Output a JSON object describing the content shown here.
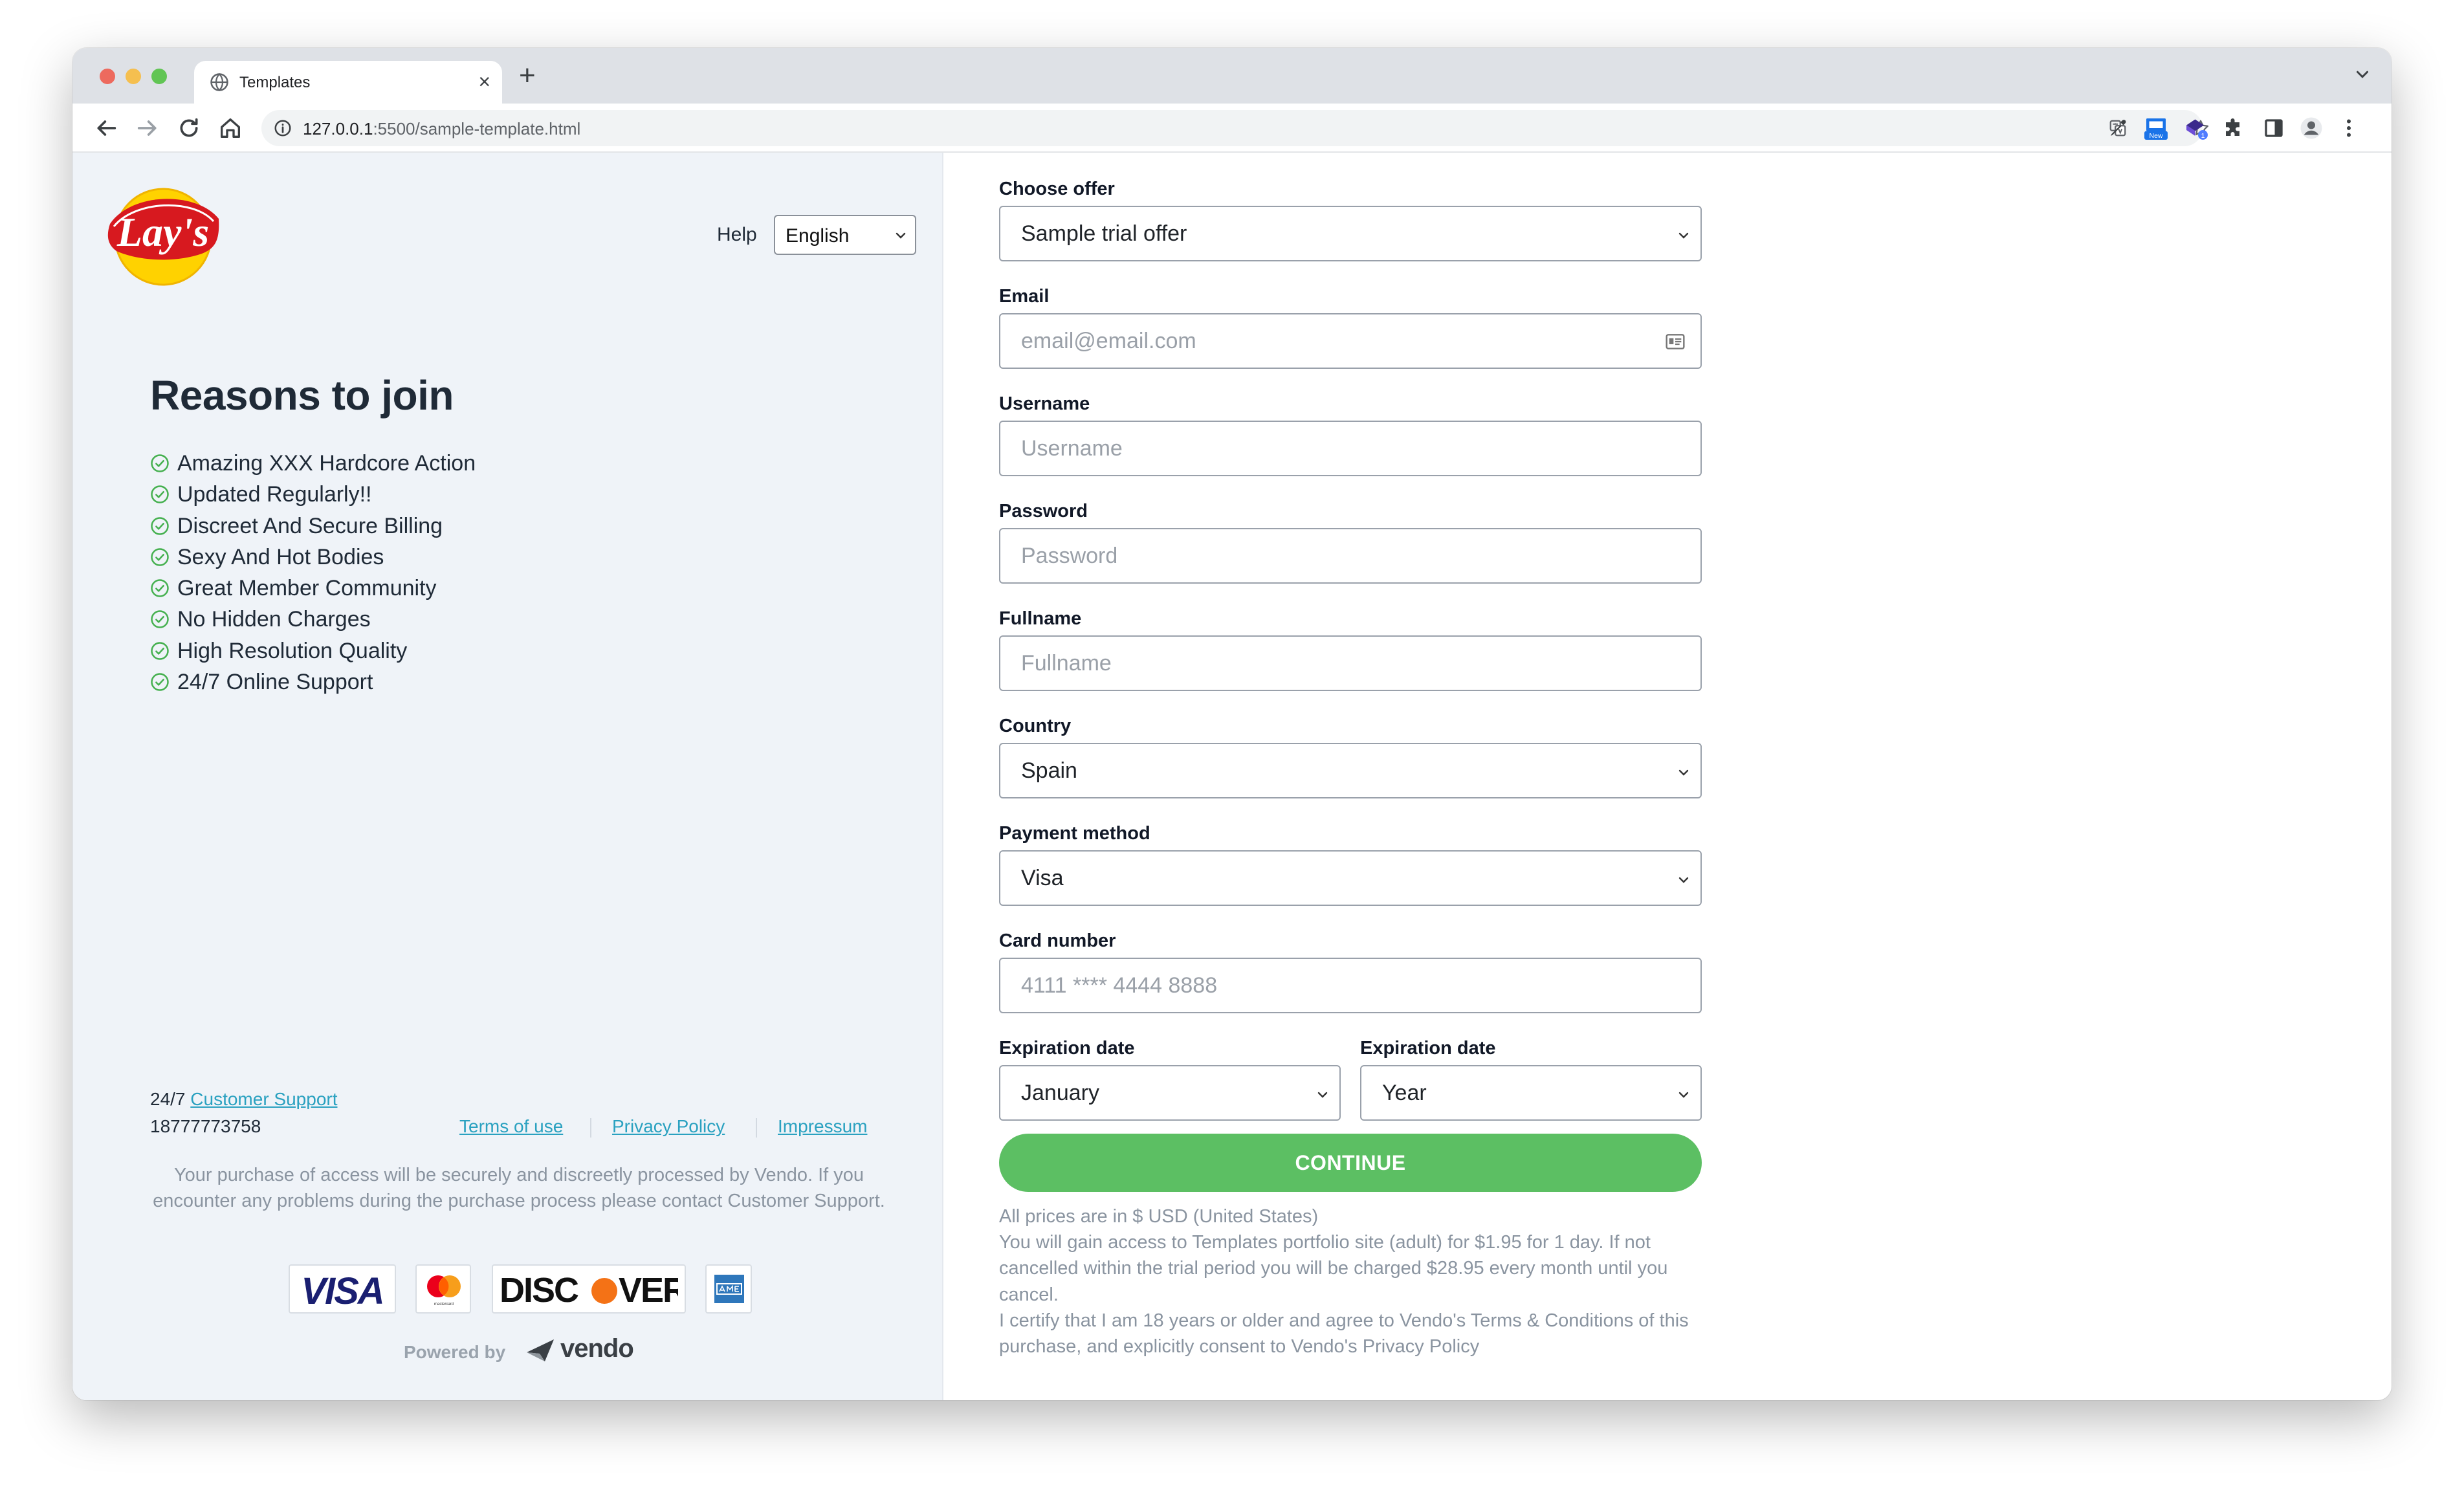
{
  "browser": {
    "tab_title": "Templates",
    "tab_close": "×",
    "new_tab": "+",
    "url_host": "127.0.0.1",
    "url_path": ":5500/sample-template.html",
    "extension_badge": "New",
    "extension_count": "1"
  },
  "brand": {
    "logo_text": "Lay's",
    "logo_colors": {
      "red": "#d7191f",
      "yellow": "#ffd200"
    }
  },
  "header": {
    "help_label": "Help",
    "language": "English"
  },
  "reasons": {
    "title": "Reasons to join",
    "items": [
      "Amazing XXX Hardcore Action",
      "Updated Regularly!!",
      "Discreet And Secure Billing",
      "Sexy And Hot Bodies",
      "Great Member Community",
      "No Hidden Charges",
      "High Resolution Quality",
      "24/7 Online Support"
    ]
  },
  "support": {
    "prefix": "24/7",
    "link_label": "Customer Support",
    "phone": "18777773758"
  },
  "footer_links": {
    "terms": "Terms of use",
    "privacy": "Privacy Policy",
    "impressum": "Impressum"
  },
  "legal_text": "Your purchase of access will be securely and discreetly processed by Vendo. If you encounter any problems during the purchase process please contact Customer Support.",
  "cards": {
    "visa": "VISA",
    "mastercard_small": "mastercard",
    "discover_left": "DISC",
    "discover_right": "VER"
  },
  "powered": {
    "label": "Powered by",
    "brand": "vendo"
  },
  "form": {
    "offer": {
      "label": "Choose offer",
      "value": "Sample trial offer"
    },
    "email": {
      "label": "Email",
      "placeholder": "email@email.com"
    },
    "username": {
      "label": "Username",
      "placeholder": "Username"
    },
    "password": {
      "label": "Password",
      "placeholder": "Password"
    },
    "fullname": {
      "label": "Fullname",
      "placeholder": "Fullname"
    },
    "country": {
      "label": "Country",
      "value": "Spain"
    },
    "payment": {
      "label": "Payment method",
      "value": "Visa"
    },
    "card": {
      "label": "Card number",
      "placeholder": "4111 **** 4444 8888"
    },
    "exp_month": {
      "label": "Expiration date",
      "value": "January"
    },
    "exp_year": {
      "label": "Expiration date",
      "value": "Year"
    },
    "continue_label": "CONTINUE",
    "terms_line1": "All prices are in $ USD (United States)",
    "terms_line2": "You will gain access to Templates portfolio site (adult) for $1.95 for 1 day. If not cancelled within the trial period you will be charged $28.95 every month until you cancel.",
    "terms_line3": "I certify that I am 18 years or older and agree to Vendo's Terms & Conditions of this purchase, and explicitly consent to Vendo's Privacy Policy"
  },
  "colors": {
    "accent_green": "#5cbf63",
    "link_blue": "#2aa1c0",
    "left_panel_bg": "#eff3f8"
  }
}
